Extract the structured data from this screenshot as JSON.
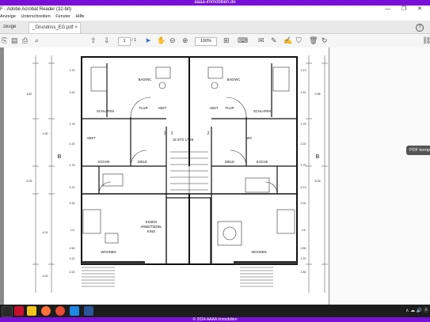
{
  "banner_top": "aaaa-immobilien.de",
  "window": {
    "title": "F - Adobe Acrobat Reader (32-bit)",
    "controls": "— ❐ ✕"
  },
  "menu": [
    "Anzeige",
    "Unterschreiben",
    "Fenster",
    "Hilfe"
  ],
  "tabs": {
    "tools": "zeuge",
    "document": "_Grundriss_EG.pdf",
    "close": "×",
    "help": "?"
  },
  "toolbar": {
    "page_current": "1",
    "page_total": "/ 1",
    "zoom": "100%"
  },
  "side_button": "PDF komp",
  "floorplan": {
    "rooms": {
      "bad_left": "BAD/WC",
      "bad_right": "BAD/WC",
      "schlafen_left": "SCHLAFEN",
      "schlafen_right": "SCHLAFEN",
      "flur_left": "FLUR",
      "flur_right": "FLUR",
      "abst_left": "ABST",
      "abst_right": "ABST",
      "abst_left2": "ABST",
      "wc_right": "WC",
      "kueche_left": "KÜCHE",
      "kueche_right": "KÜCHE",
      "diele_left": "DIELE",
      "diele_right": "DIELE",
      "essen": "ESSEN",
      "arbeitsdiel": "ARBEITSDIEL",
      "kino": "KINO",
      "wohnen_left": "WOHNEN",
      "wohnen_right": "WOHNEN",
      "stair": "18 STG 17/28"
    },
    "dims": {
      "d1": "1.13",
      "d2": "1.13",
      "d3": "1.51",
      "d4": "1.51",
      "d5": "1.75",
      "d6": "1.75",
      "d7": "2.22",
      "d8": "2.22",
      "d9": "1.75",
      "d10": "1.75",
      "d11": "2.13",
      "d12": "2.13",
      "d13": "4.87",
      "d14": "3.98",
      "d15": "2.32",
      "d16": "2.32",
      "d17": "6.25",
      "d18": "6.25",
      "d19": "1.6",
      "d20": "1.6",
      "d21": "2.50",
      "d22": "2.50",
      "d23": "1.00",
      "d24": "4.21",
      "d25": "1.22",
      "d26": "1.22",
      "d27": "1.00",
      "d28": "2.22",
      "d29": "2.82"
    },
    "markers": {
      "b_left": "B",
      "b_right": "B",
      "r1": "1",
      "r2": "1",
      "r3": "2"
    }
  },
  "taskbar": {
    "tray_text": "∧ ☁ 🔊 Ⓐ"
  },
  "banner_bottom": "© 2024 AAAA Immobilien"
}
